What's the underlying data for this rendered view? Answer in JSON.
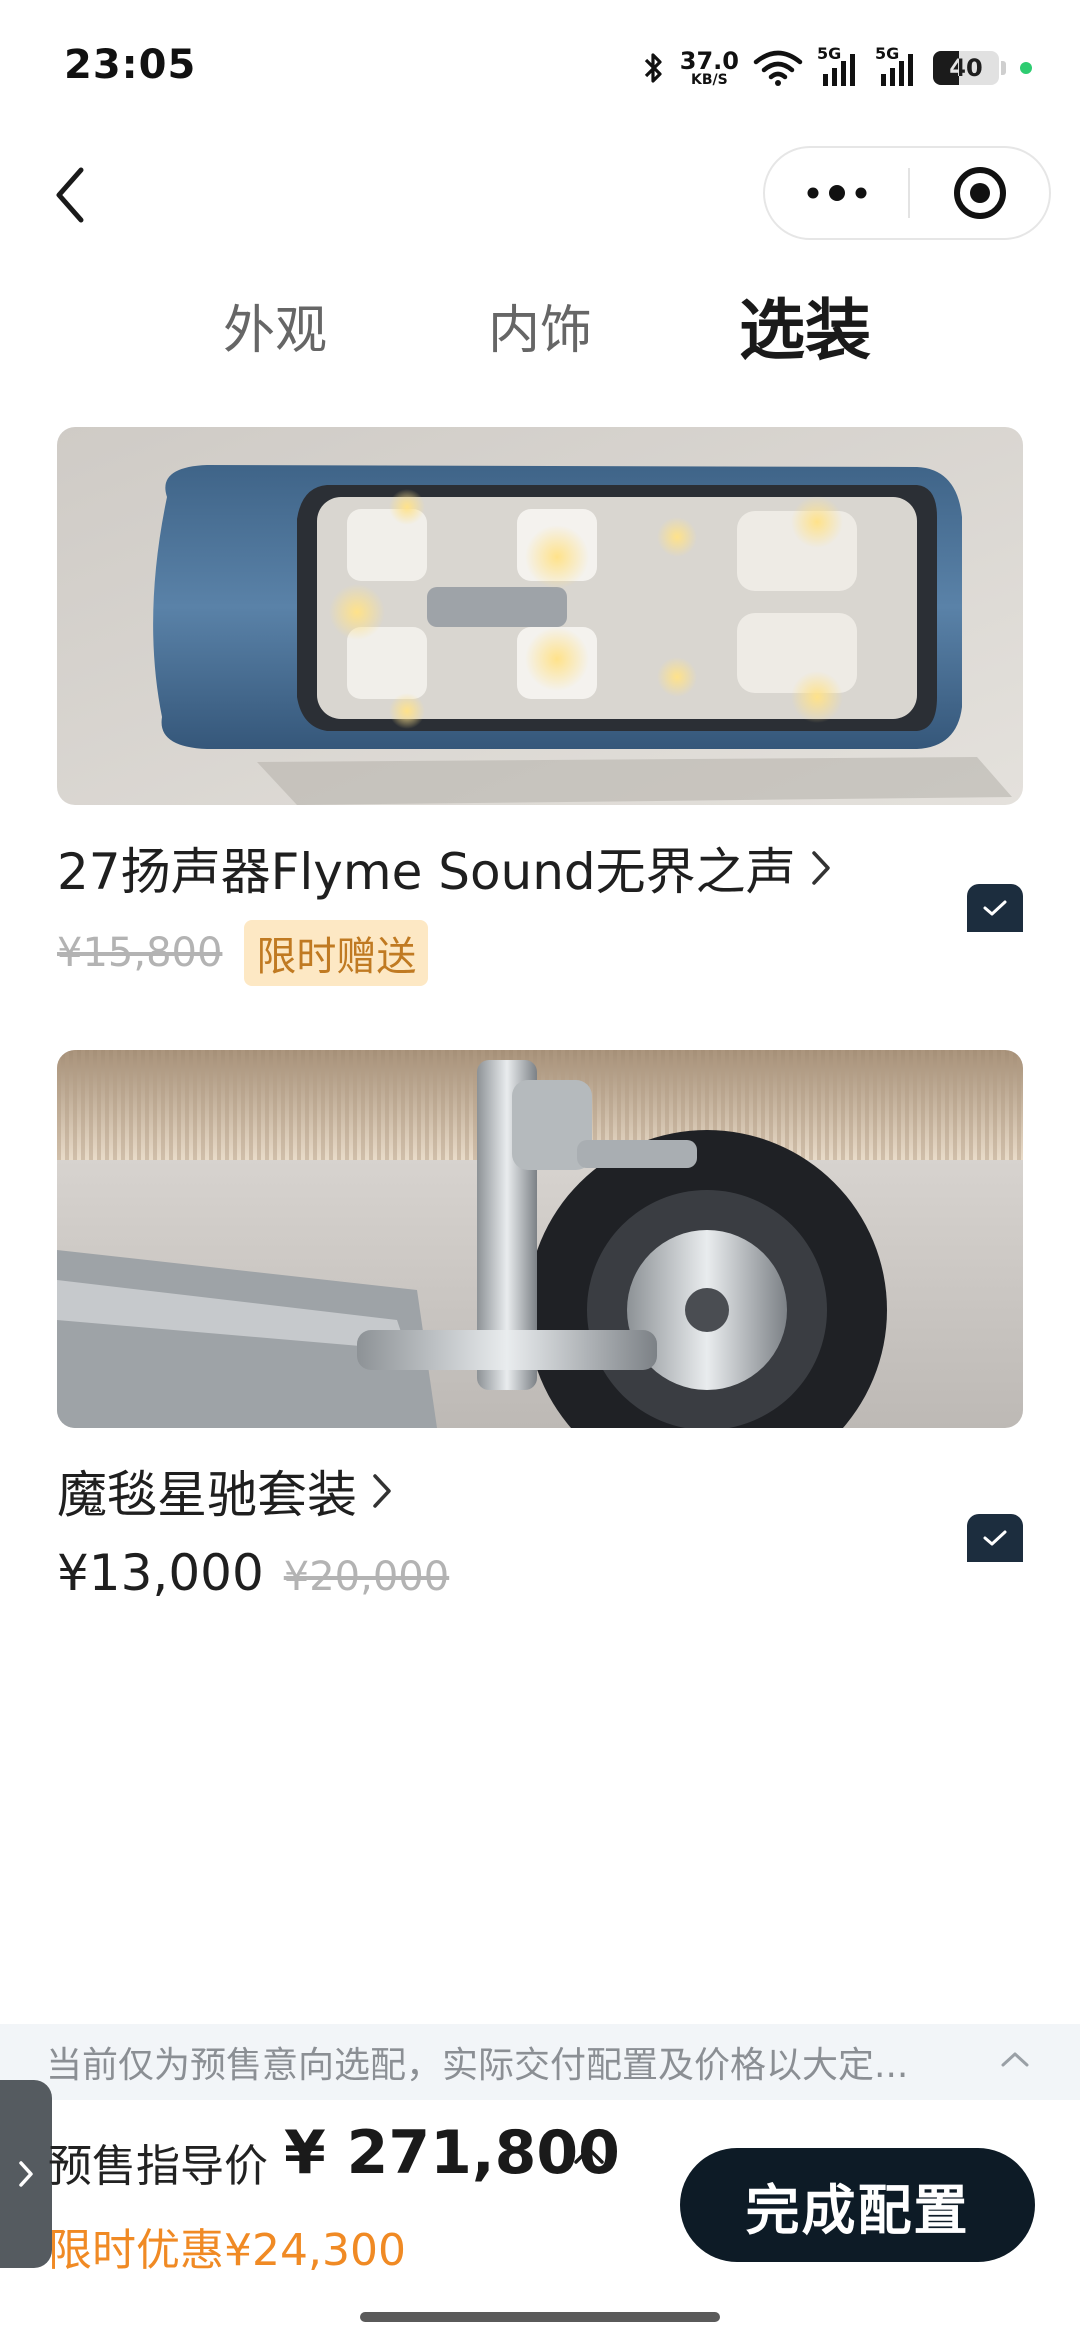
{
  "status_bar": {
    "time": "23:05",
    "net_speed_value": "37.0",
    "net_speed_unit": "KB/S",
    "signal_1": "5G",
    "signal_2": "5G",
    "battery_level": "40",
    "battery_fraction": 0.4
  },
  "nav": {
    "back_icon": "chevron-left-icon",
    "more_icon": "more-dots-icon",
    "close_icon": "target-close-icon"
  },
  "tabs": [
    {
      "label": "外观",
      "active": false
    },
    {
      "label": "内饰",
      "active": false
    },
    {
      "label": "选装",
      "active": true
    }
  ],
  "options": [
    {
      "title": "27扬声器Flyme Sound无界之声",
      "original_price": "¥15,800",
      "promo_tag": "限时赠送",
      "checked": true
    },
    {
      "title": "魔毯星驰套装",
      "price": "¥13,000",
      "original_price": "¥20,000",
      "checked": true
    }
  ],
  "notice": {
    "text": "当前仅为预售意向选配，实际交付配置及价格以大定..."
  },
  "bottom_bar": {
    "price_label": "预售指导价",
    "total_price": "¥ 271,800",
    "discount": "限时优惠¥24,300",
    "finish_button": "完成配置"
  },
  "colors": {
    "accent_orange": "#f08a24",
    "button_dark": "#0d1b26",
    "checkbox": "#1c2d3e",
    "promo_bg": "#fde8c4"
  }
}
